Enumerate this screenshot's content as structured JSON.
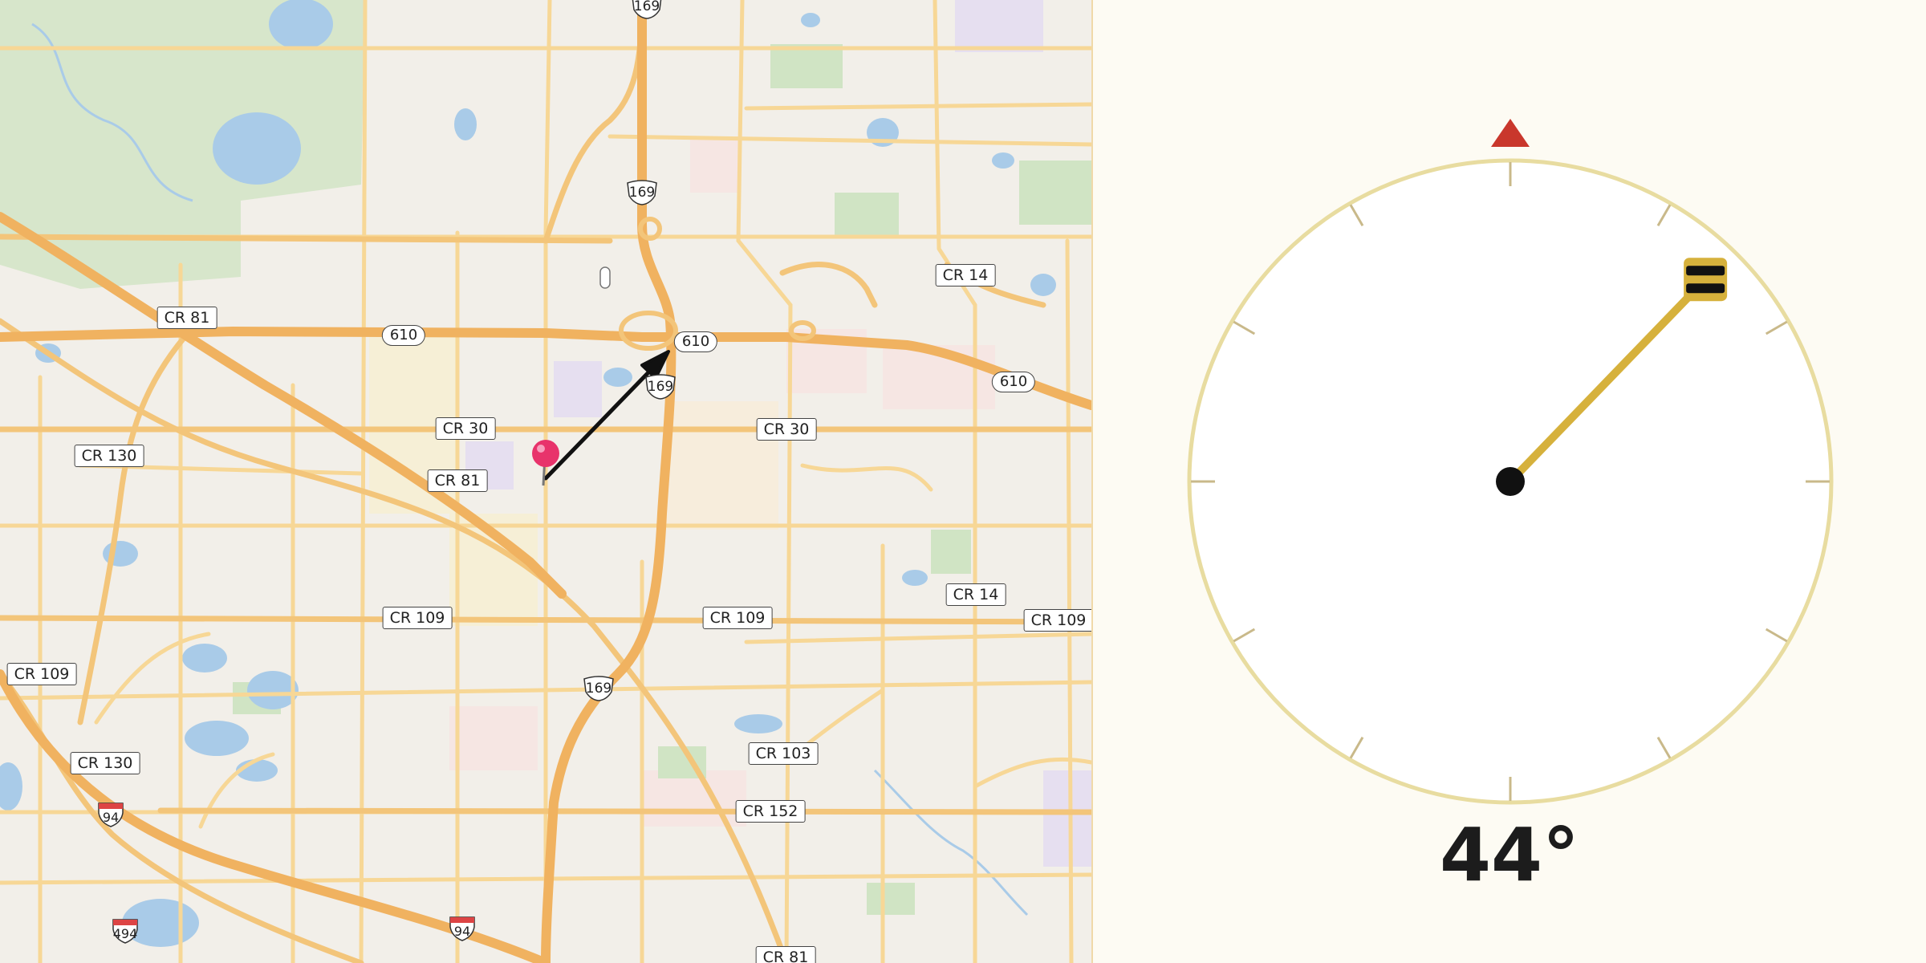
{
  "map": {
    "road_labels": [
      {
        "text": "CR 81"
      },
      {
        "text": "CR 14"
      },
      {
        "text": "CR 30"
      },
      {
        "text": "CR 130"
      },
      {
        "text": "CR 81"
      },
      {
        "text": "CR 30"
      },
      {
        "text": "CR 109"
      },
      {
        "text": "CR 109"
      },
      {
        "text": "CR 14"
      },
      {
        "text": "CR 109"
      },
      {
        "text": "CR 109"
      },
      {
        "text": "CR 130"
      },
      {
        "text": "CR 103"
      },
      {
        "text": "CR 152"
      },
      {
        "text": "CR 81"
      }
    ],
    "route_shields": [
      {
        "text": "610"
      },
      {
        "text": "610"
      },
      {
        "text": "610"
      }
    ],
    "us_shields": [
      {
        "text": "169"
      },
      {
        "text": "169"
      },
      {
        "text": "169"
      },
      {
        "text": "169"
      }
    ],
    "interstate_shields": [
      {
        "text": "94"
      },
      {
        "text": "494"
      },
      {
        "text": "94"
      }
    ],
    "marker_color": "#e8336b",
    "arrow_color": "#111111"
  },
  "compass": {
    "bearing_value": 44,
    "bearing_text": "44°",
    "north_marker_color": "#c9372c",
    "needle_color": "#d6b13c",
    "ring_color": "#e8dca0"
  }
}
